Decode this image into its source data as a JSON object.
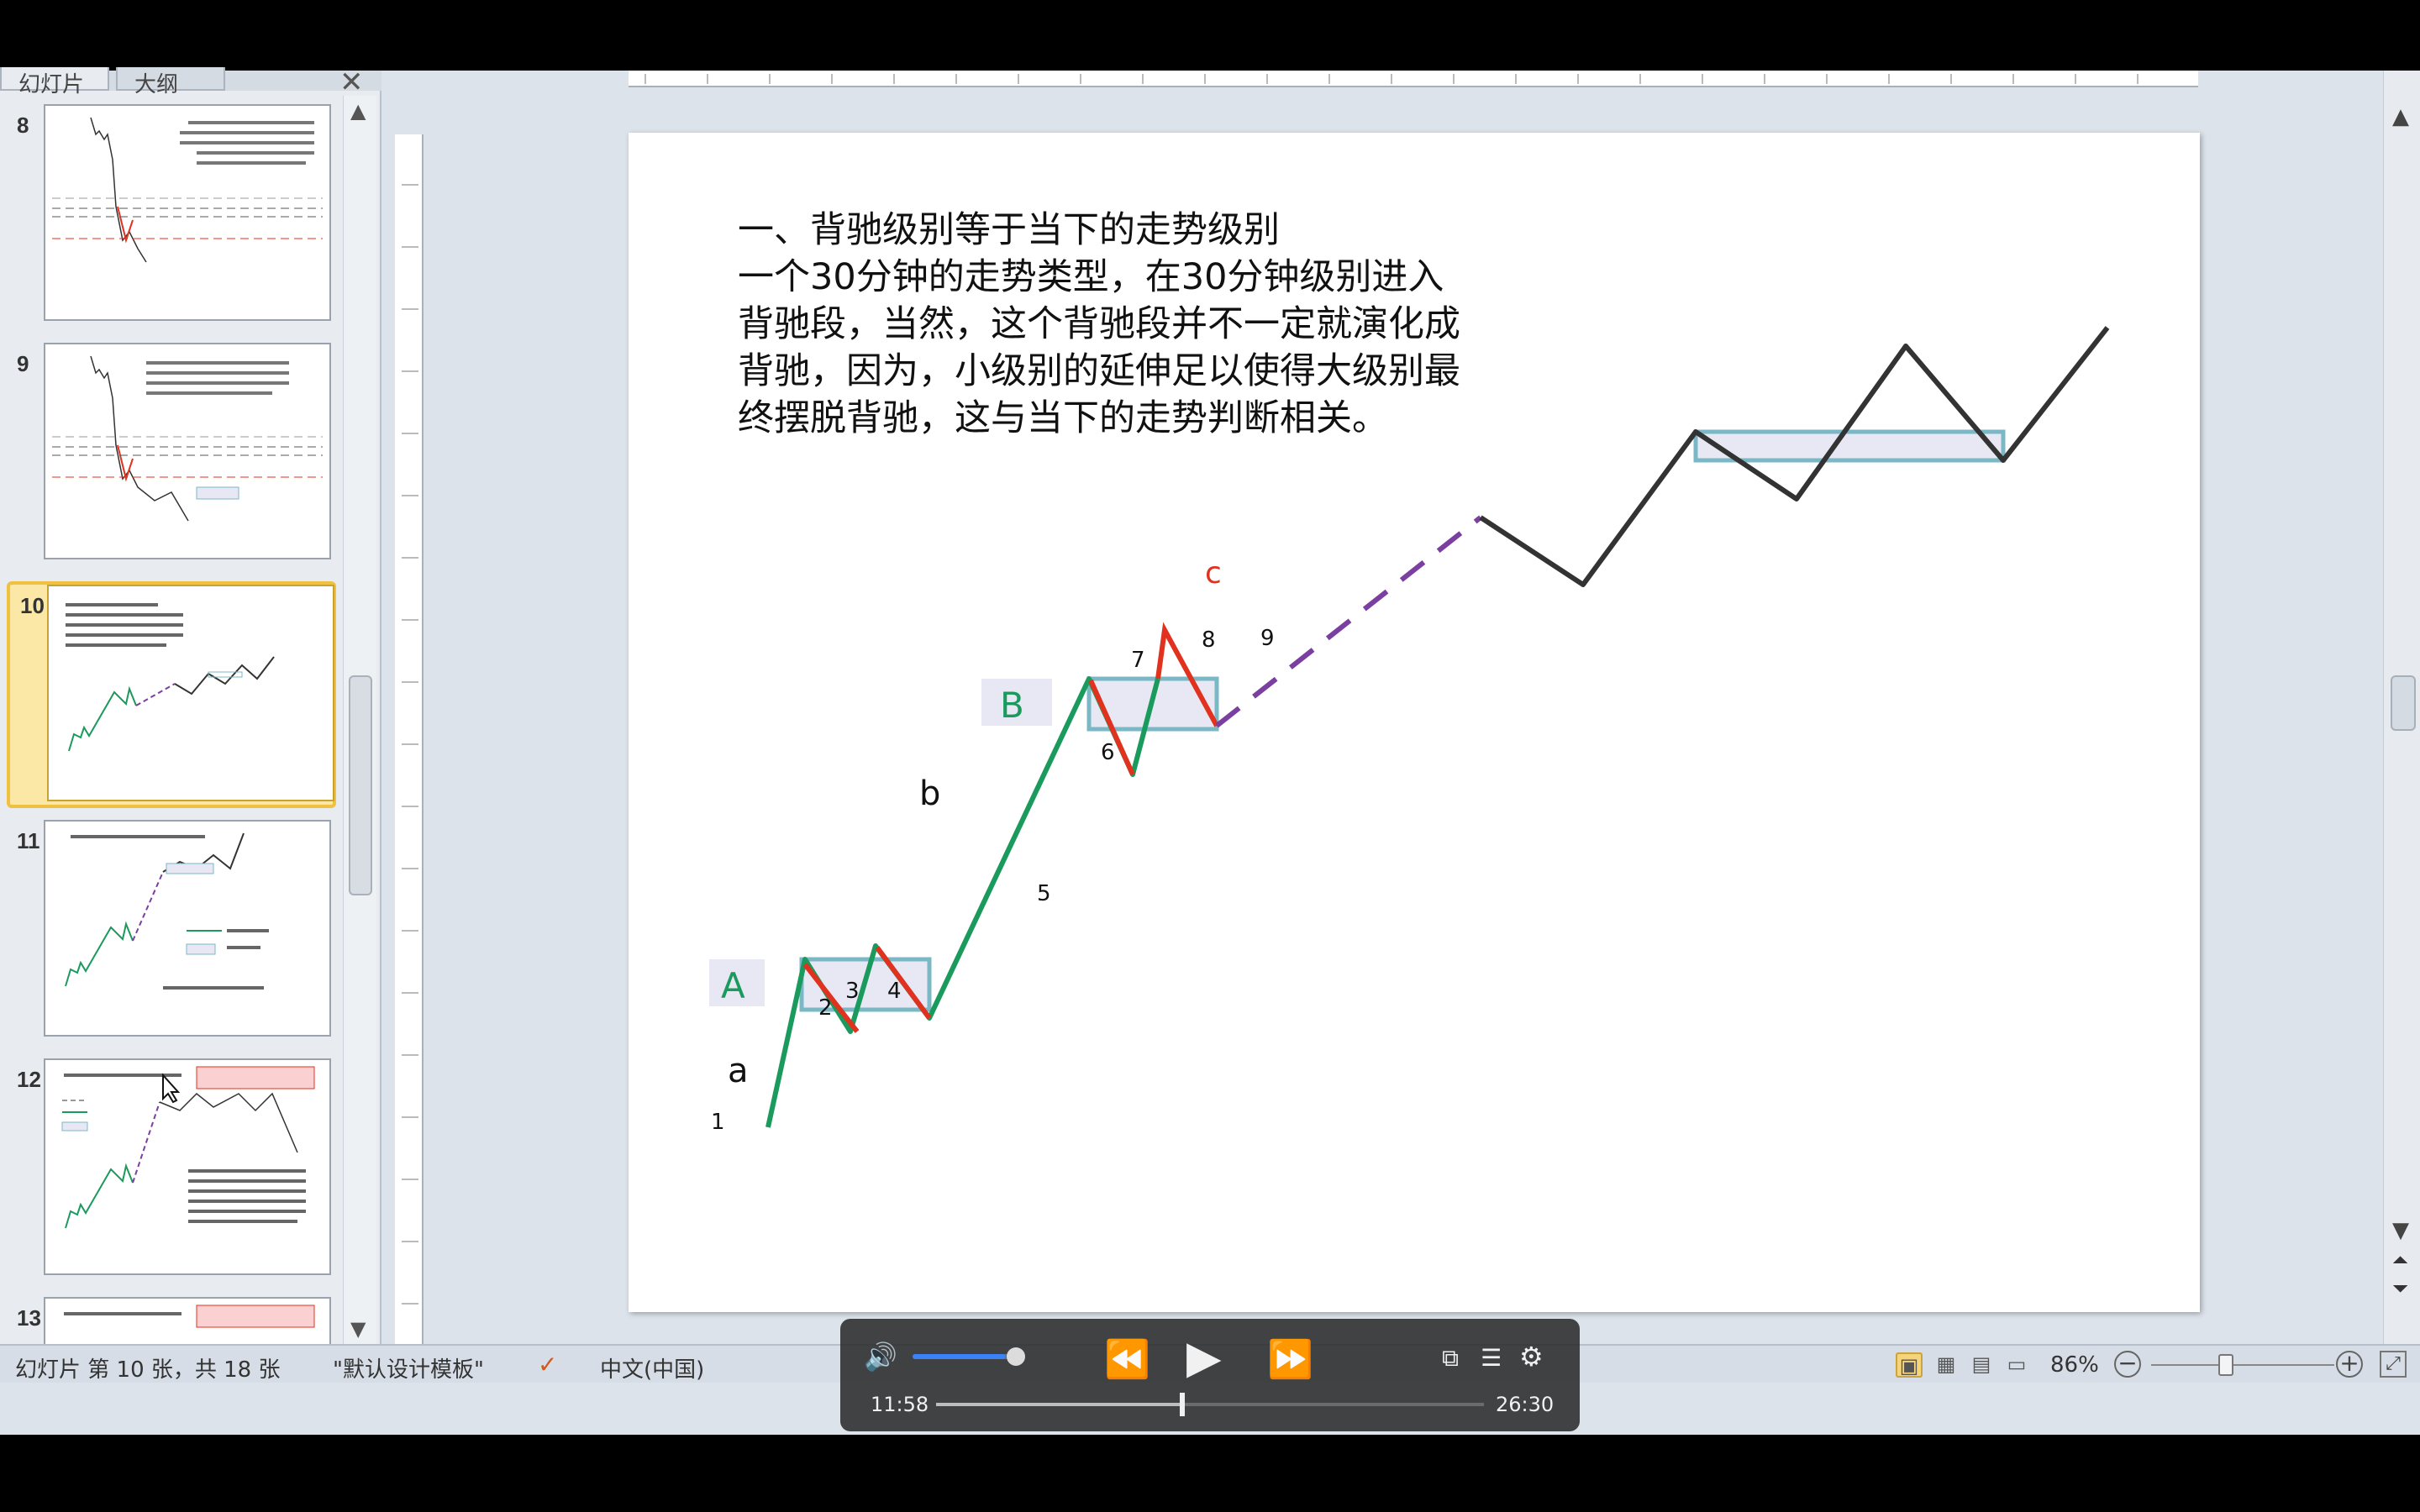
{
  "pane": {
    "tab_slides": "幻灯片",
    "tab_outline": "大纲",
    "close_glyph": "✕",
    "thumbnails": [
      {
        "number": "8",
        "selected": false
      },
      {
        "number": "9",
        "selected": false
      },
      {
        "number": "10",
        "selected": true
      },
      {
        "number": "11",
        "selected": false
      },
      {
        "number": "12",
        "selected": false
      },
      {
        "number": "13",
        "selected": false
      }
    ]
  },
  "slide": {
    "text_lines": [
      "一、背驰级别等于当下的走势级别",
      "一个30分钟的走势类型，在30分钟级别进入",
      "背驰段，当然，这个背驰段并不一定就演化成",
      "背驰，因为，小级别的延伸足以使得大级别最",
      "终摆脱背驰，这与当下的走势判断相关。"
    ],
    "labels": {
      "a": "a",
      "b": "b",
      "c": "c",
      "A": "A",
      "B": "B",
      "n1": "1",
      "n2": "2",
      "n3": "3",
      "n4": "4",
      "n5": "5",
      "n6": "6",
      "n7": "7",
      "n8": "8",
      "n9": "9"
    },
    "colors": {
      "green": "#1a9a5c",
      "red": "#e0321e",
      "black": "#333333",
      "purple": "#7a3fa0",
      "box_stroke": "#7ab8c6",
      "box_fill": "#e8e8f4",
      "c_label": "#e0321e",
      "hub_label": "#1a9a5c"
    }
  },
  "status": {
    "slide_info": "幻灯片 第 10 张，共 18 张",
    "theme": "\"默认设计模板\"",
    "language": "中文(中国)",
    "zoom": "86%"
  },
  "player": {
    "current_time": "11:58",
    "duration": "26:30",
    "progress_fraction": 0.45,
    "volume_fraction": 0.88
  },
  "icons": {
    "speaker": "🔊",
    "rewind": "⏪",
    "play": "▶",
    "ffwd": "⏩",
    "pip": "⧉",
    "chapters": "☰",
    "settings": "⚙",
    "scroll_up": "▲",
    "scroll_down": "▼",
    "prev_slide": "⏶",
    "next_slide": "⏷",
    "stop": "⏮",
    "pause": "⏸",
    "eject": "⏏"
  }
}
